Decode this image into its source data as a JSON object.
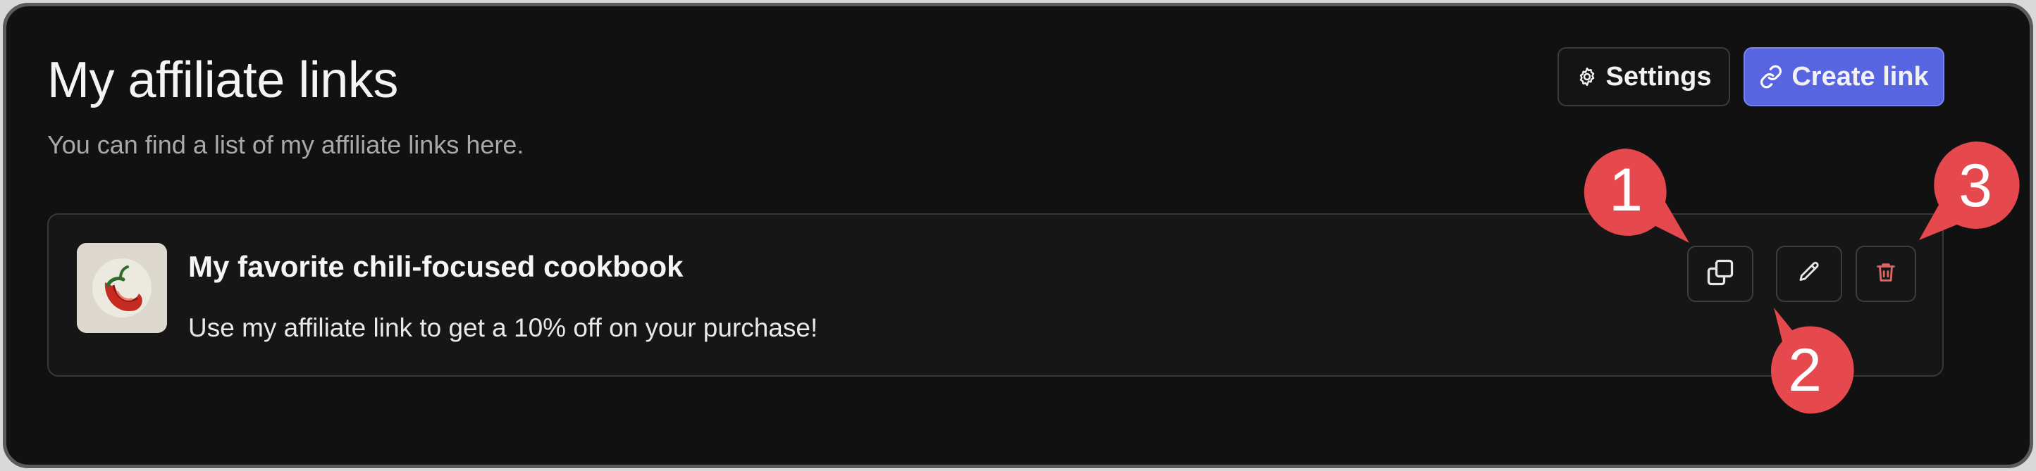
{
  "header": {
    "title": "My affiliate links",
    "subtitle": "You can find a list of my affiliate links here.",
    "settings_label": "Settings",
    "create_label": "Create link"
  },
  "links": [
    {
      "title": "My favorite chili-focused cookbook",
      "description": "Use my affiliate link to get a 10% off on your purchase!",
      "thumbnail_icon": "chili-pepper-icon",
      "actions": [
        "copy-icon",
        "pencil-icon",
        "trash-icon"
      ]
    }
  ],
  "callouts": [
    "1",
    "2",
    "3"
  ],
  "colors": {
    "background": "#111111",
    "accent": "#5865e0",
    "callout": "#e5484d",
    "danger": "#e06666"
  }
}
